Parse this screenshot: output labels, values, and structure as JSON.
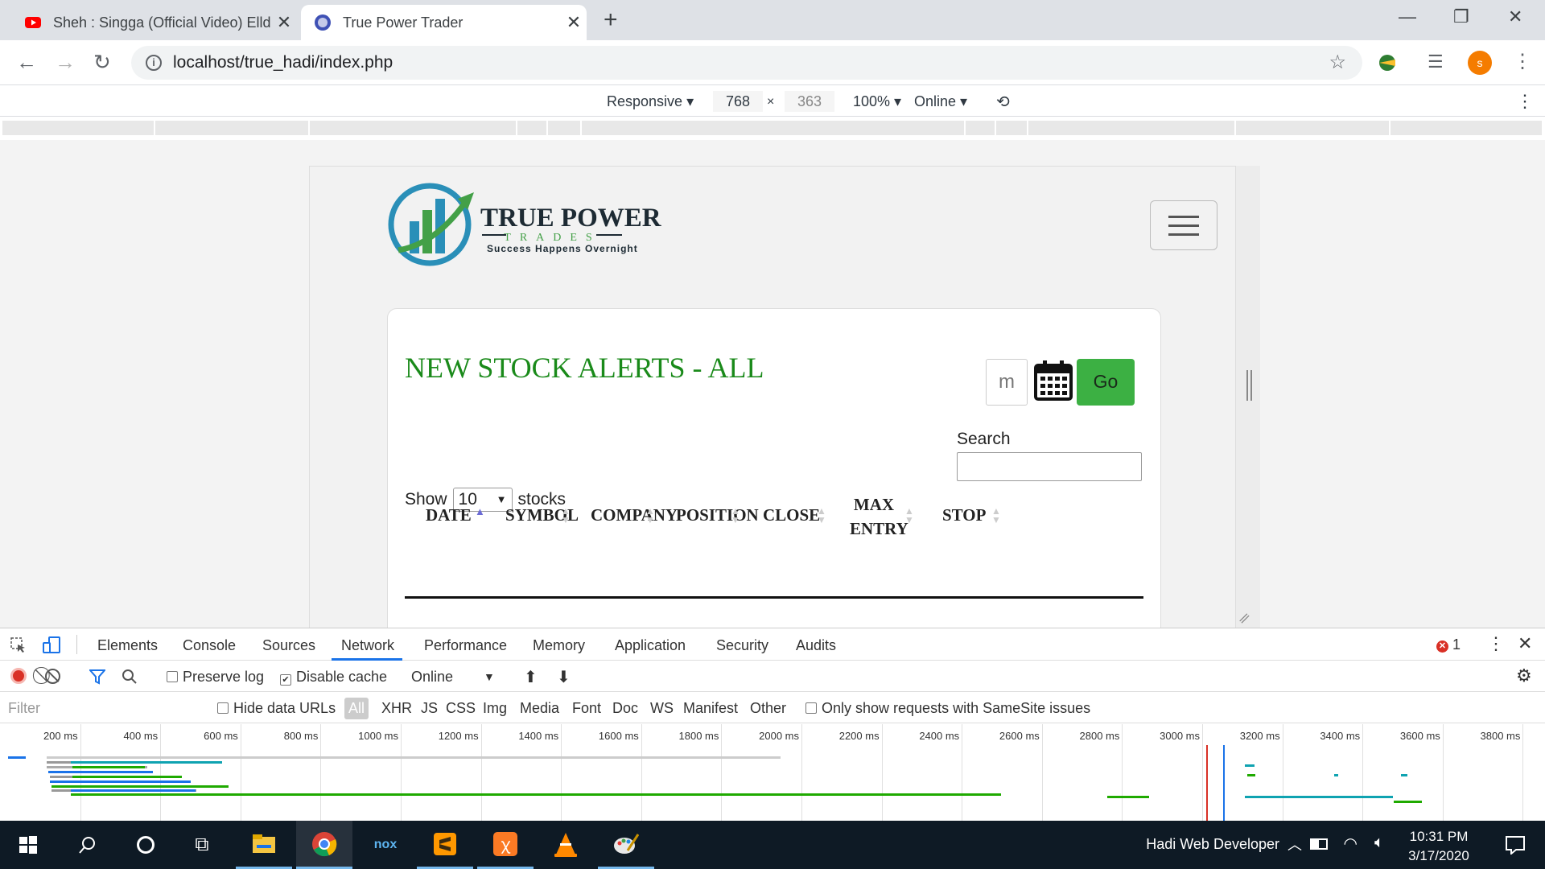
{
  "browser": {
    "tabs": [
      {
        "title": "Sheh : Singga (Official Video) Elld",
        "icon": "youtube-icon"
      },
      {
        "title": "True Power Trader",
        "icon": "globe-icon"
      }
    ],
    "url": "localhost/true_hadi/index.php",
    "profile_initial": "s"
  },
  "device_toolbar": {
    "mode": "Responsive",
    "width": "768",
    "times": "×",
    "height": "363",
    "zoom": "100%",
    "network": "Online"
  },
  "site": {
    "logo_title": "TRUE POWER",
    "logo_sub": "TRADES",
    "logo_tag": "Success Happens Overnight",
    "alerts_title": "NEW STOCK ALERTS - ALL",
    "date_value": "m",
    "go_label": "Go",
    "search_label": "Search",
    "show_label": "Show",
    "show_value": "10",
    "stocks_label": "stocks",
    "columns": [
      "DATE",
      "SYMBOL",
      "COMPANY",
      "POSITION",
      "CLOSE",
      "MAX",
      "ENTRY",
      "STOP"
    ]
  },
  "devtools": {
    "tabs": [
      "Elements",
      "Console",
      "Sources",
      "Network",
      "Performance",
      "Memory",
      "Application",
      "Security",
      "Audits"
    ],
    "active_tab": "Network",
    "error_count": "1",
    "preserve_log": "Preserve log",
    "disable_cache": "Disable cache",
    "throttle": "Online",
    "filter_placeholder": "Filter",
    "hide_data_urls": "Hide data URLs",
    "types": [
      "All",
      "XHR",
      "JS",
      "CSS",
      "Img",
      "Media",
      "Font",
      "Doc",
      "WS",
      "Manifest",
      "Other"
    ],
    "samesite": "Only show requests with SameSite issues",
    "ticks": [
      "200 ms",
      "400 ms",
      "600 ms",
      "800 ms",
      "1000 ms",
      "1200 ms",
      "1400 ms",
      "1600 ms",
      "1800 ms",
      "2000 ms",
      "2200 ms",
      "2400 ms",
      "2600 ms",
      "2800 ms",
      "3000 ms",
      "3200 ms",
      "3400 ms",
      "3600 ms",
      "3800 ms"
    ]
  },
  "taskbar": {
    "user": "Hadi Web Developer",
    "time": "10:31 PM",
    "date": "3/17/2020"
  },
  "colors": {
    "accent_green": "#3cb043",
    "title_green": "#1a8a1a",
    "network_blue": "#1a73e8"
  }
}
